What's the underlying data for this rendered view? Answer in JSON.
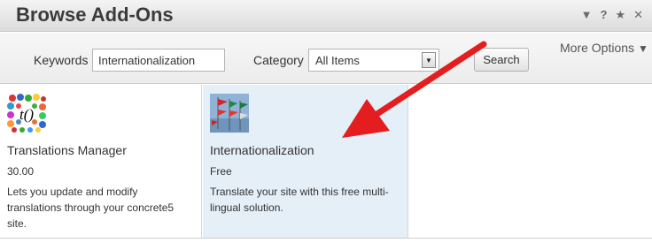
{
  "window": {
    "title": "Browse Add-Ons",
    "icons": [
      "collapse-icon",
      "help-icon",
      "star-icon",
      "close-icon"
    ],
    "icon_glyphs": [
      "▼",
      "?",
      "★",
      "✕"
    ]
  },
  "filters": {
    "keywords_label": "Keywords",
    "keywords_value": "Internationalization",
    "category_label": "Category",
    "category_value": "All Items",
    "search_label": "Search",
    "more_options_label": "More Options"
  },
  "addons": [
    {
      "name": "Translations Manager",
      "price": "30.00",
      "description": "Lets you update and modify translations through your concrete5 site.",
      "icon": "translations-manager-icon"
    },
    {
      "name": "Internationalization",
      "price": "Free",
      "description": "Translate your site with this free multi-lingual solution.",
      "icon": "internationalization-flags-icon"
    }
  ],
  "colors": {
    "annotation_arrow": "#e41e1e",
    "selected_card_bg": "#e4eff8"
  }
}
